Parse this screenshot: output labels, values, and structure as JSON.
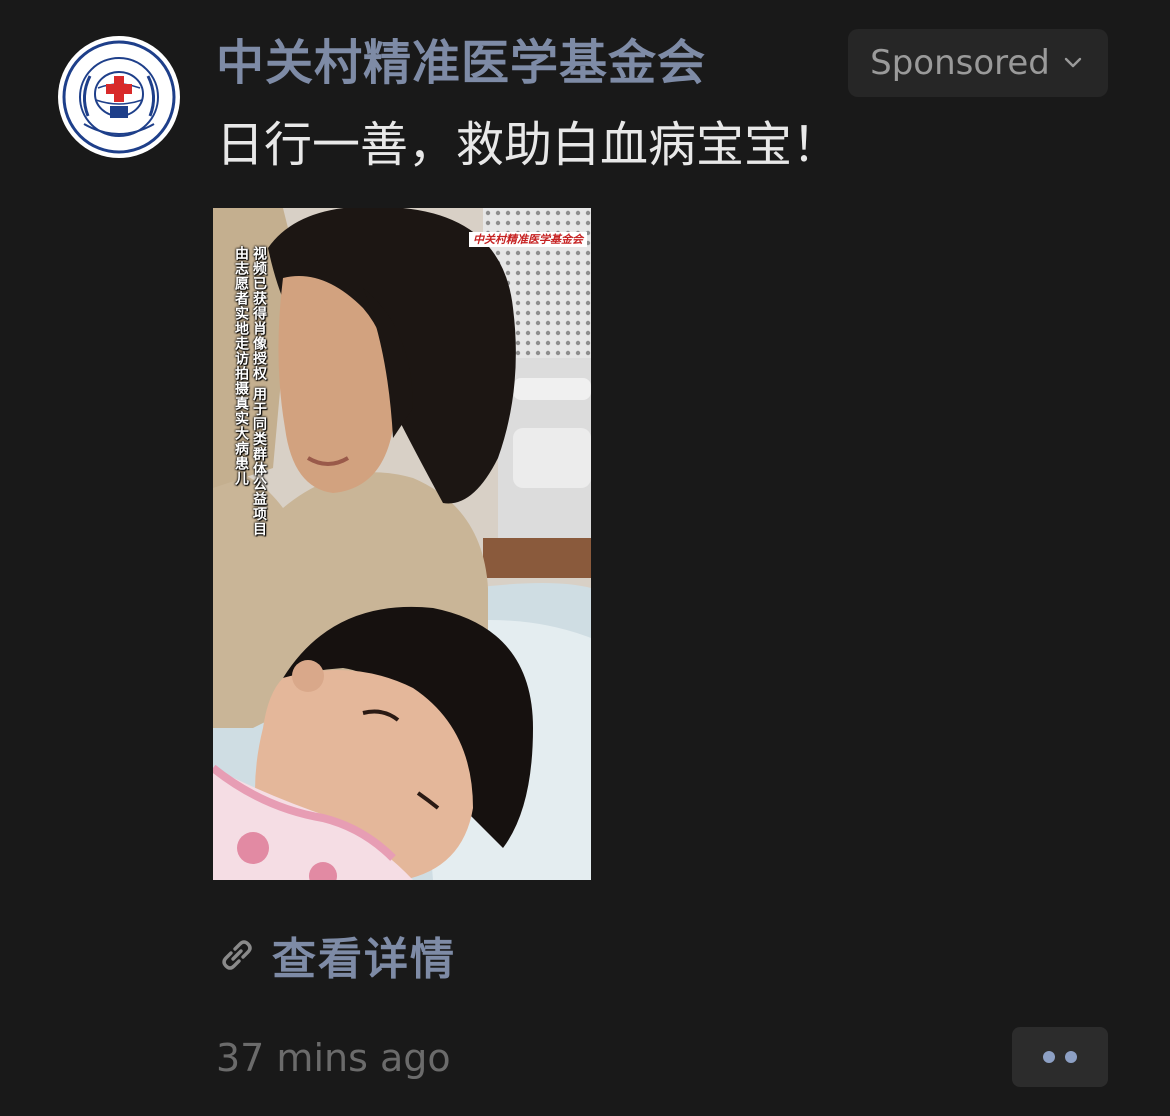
{
  "post": {
    "author": "中关村精准医学基金会",
    "sponsored_label": "Sponsored",
    "text": "日行一善，救助白血病宝宝！",
    "media": {
      "watermark": "中关村精准医学基金会",
      "caption_line_1": "视频已获得肖像授权 用于同类群体公益项目",
      "caption_line_2": "由志愿者实地走访拍摄真实大病患儿"
    },
    "link_label": "查看详情",
    "timestamp": "37 mins ago"
  },
  "icons": {
    "avatar": "foundation-logo-icon",
    "sponsored_menu": "chevron-down-icon",
    "link": "link-icon",
    "more": "more-dots-icon"
  },
  "colors": {
    "background": "#191919",
    "author_name": "#7e8ba6",
    "link": "#7e8ba6",
    "post_text": "#e8e8e8",
    "timestamp": "#6b6b6b",
    "button_bg": "#262626",
    "more_dots": "#8da0c4"
  }
}
